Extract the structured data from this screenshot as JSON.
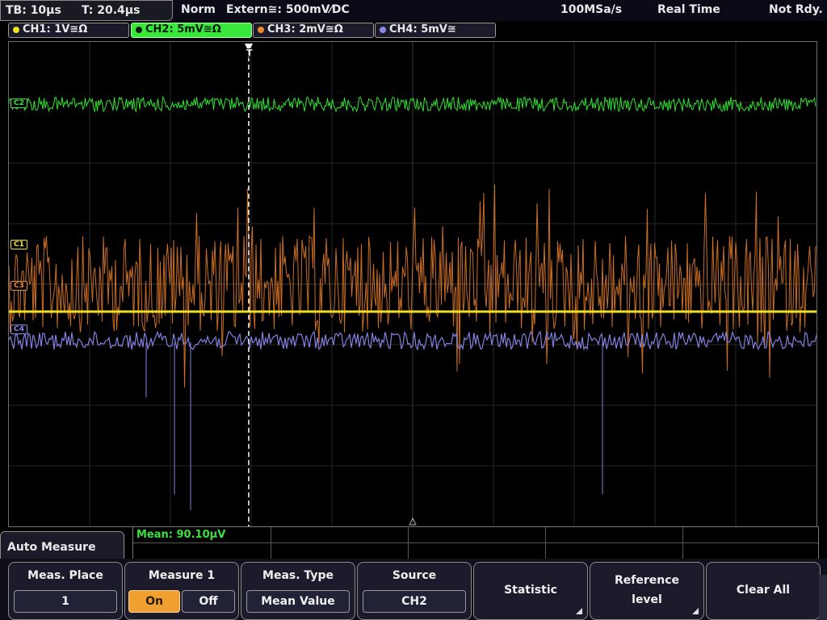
{
  "status": {
    "timebase": "TB: 10µs",
    "trigger_time": "T: 20.4µs",
    "mode": "Norm",
    "trigger_source": "Extern≅: 500mV⁄DC",
    "sample_rate": "100MSa/s",
    "acq_mode": "Real Time",
    "trigger_state": "Not Rdy."
  },
  "channels": [
    {
      "label": "CH1: 1V≅Ω",
      "color": "#f0e020",
      "active": false
    },
    {
      "label": "CH2: 5mV≅Ω",
      "color": "#39e83a",
      "active": true
    },
    {
      "label": "CH3: 2mV≅Ω",
      "color": "#f08a30",
      "active": false
    },
    {
      "label": "CH4: 5mV≅",
      "color": "#8b88e8",
      "active": false
    }
  ],
  "markers": {
    "c2": "C2",
    "c1": "C1",
    "c3": "C3",
    "c4": "C4",
    "trigger": "T"
  },
  "measurement": {
    "readout": "Mean: 90.10µV"
  },
  "menu": {
    "title": "Auto Measure",
    "softkeys": [
      {
        "title": "Meas. Place",
        "value": "1"
      },
      {
        "title": "Measure 1",
        "on": "On",
        "off": "Off",
        "selected": "On"
      },
      {
        "title": "Meas. Type",
        "value": "Mean Value"
      },
      {
        "title": "Source",
        "value": "CH2"
      },
      {
        "title": "Statistic"
      },
      {
        "title_line1": "Reference",
        "title_line2": "level"
      },
      {
        "title": "Clear All"
      }
    ]
  }
}
